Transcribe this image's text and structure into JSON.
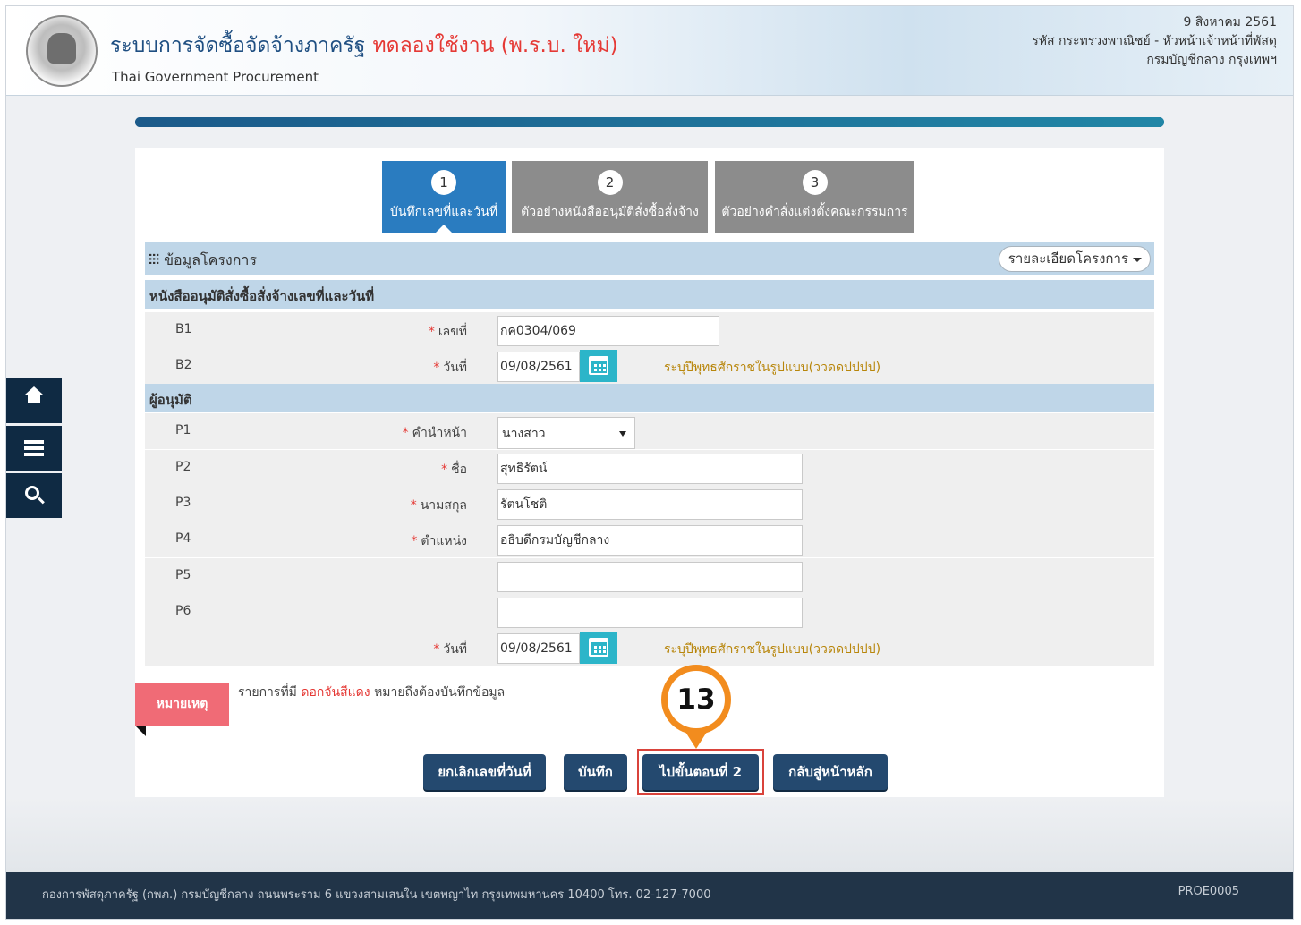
{
  "header": {
    "title": "ระบบการจัดซื้อจัดจ้างภาครัฐ",
    "trial": "ทดลองใช้งาน (พ.ร.บ. ใหม่)",
    "subtitle": "Thai Government Procurement",
    "date": "9 สิงหาคม 2561",
    "user_line": "รหัส กระทรวงพาณิชย์ - หัวหน้าเจ้าหน้าที่พัสดุ",
    "dept_line": "กรมบัญชีกลาง กรุงเทพฯ"
  },
  "progress": {
    "fraction": 1.0
  },
  "steps": [
    {
      "num": "1",
      "label": "บันทึกเลขที่และวันที่",
      "active": true
    },
    {
      "num": "2",
      "label": "ตัวอย่างหนังสืออนุมัติสั่งซื้อสั่งจ้าง",
      "active": false
    },
    {
      "num": "3",
      "label": "ตัวอย่างคำสั่งแต่งตั้งคณะกรรมการ",
      "active": false
    }
  ],
  "project": {
    "title": "ข้อมูลโครงการ",
    "detail_button": "รายละเอียดโครงการ",
    "icon": "sliders-icon"
  },
  "section_order": {
    "title": "หนังสืออนุมัติสั่งซื้อสั่งจ้างเลขที่และวันที่",
    "rows": [
      {
        "code": "B1",
        "label": "เลขที่",
        "value": "กค0304/069"
      },
      {
        "code": "B2",
        "label": "วันที่",
        "value": "09/08/2561",
        "hint": "ระบุปีพุทธศักราชในรูปแบบ(ววดดปปปป)"
      }
    ]
  },
  "section_approver": {
    "title": "ผู้อนุมัติ",
    "rows": [
      {
        "code": "P1",
        "label": "คำนำหน้า",
        "value": "นางสาว"
      },
      {
        "code": "P2",
        "label": "ชื่อ",
        "value": "สุทธิรัตน์"
      },
      {
        "code": "P3",
        "label": "นามสกุล",
        "value": "รัตนโชติ"
      },
      {
        "code": "P4",
        "label": "ตำแหน่ง",
        "value": "อธิบดีกรมบัญชีกลาง"
      },
      {
        "code": "P5",
        "value": ""
      },
      {
        "code": "P6",
        "value": ""
      },
      {
        "label": "วันที่",
        "value": "09/08/2561",
        "hint": "ระบุปีพุทธศักราชในรูปแบบ(ววดดปปปป)"
      }
    ]
  },
  "required_mark": "*",
  "note": {
    "tag": "หมายเหตุ",
    "prefix": "รายการที่มี",
    "red": "ดอกจันสีแดง",
    "suffix": "หมายถึงต้องบันทึกข้อมูล"
  },
  "buttons": {
    "cancel": "ยกเลิกเลขที่วันที่",
    "save": "บันทึก",
    "next": "ไปขั้นตอนที่ 2",
    "home": "กลับสู่หน้าหลัก"
  },
  "marker": "13",
  "footer": {
    "text": "กองการพัสดุภาครัฐ (กพภ.) กรมบัญชีกลาง ถนนพระราม 6 แขวงสามเสนใน เขตพญาไท กรุงเทพมหานคร 10400 โทร. 02-127-7000",
    "code": "PROE0005"
  },
  "colors": {
    "accent": "#2a7cc0",
    "section": "#bfd6e8",
    "button": "#24496f",
    "required": "#e53935",
    "marker": "#f28c1e"
  }
}
